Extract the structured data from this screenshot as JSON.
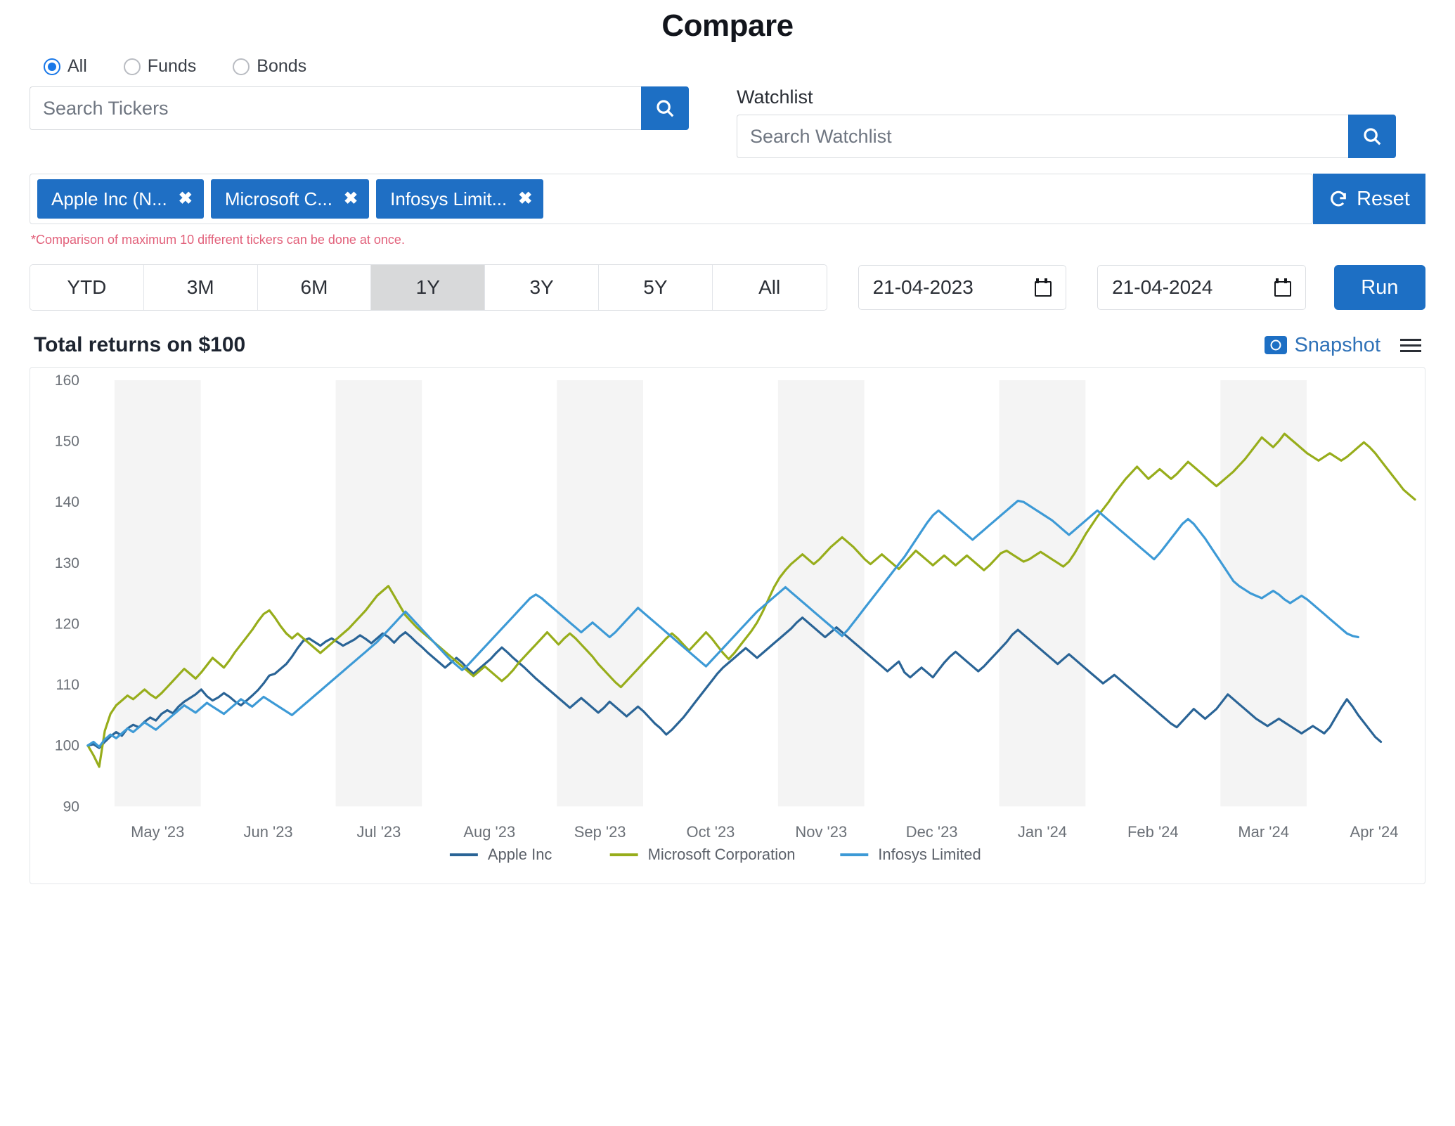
{
  "header": {
    "title": "Compare"
  },
  "filters": {
    "options": [
      {
        "label": "All",
        "checked": true
      },
      {
        "label": "Funds",
        "checked": false
      },
      {
        "label": "Bonds",
        "checked": false
      }
    ]
  },
  "search": {
    "tickers_placeholder": "Search Tickers",
    "tickers_value": "",
    "search_icon": "search-icon"
  },
  "watchlist": {
    "label": "Watchlist",
    "placeholder": "Search Watchlist",
    "value": "",
    "search_icon": "search-icon"
  },
  "chips": [
    {
      "label": "Apple Inc (N...",
      "remove": "✖"
    },
    {
      "label": "Microsoft C...",
      "remove": "✖"
    },
    {
      "label": "Infosys Limit...",
      "remove": "✖"
    }
  ],
  "reset": {
    "label": "Reset",
    "icon": "refresh-icon"
  },
  "note": "*Comparison of maximum 10 different tickers can be done at once.",
  "periods": [
    {
      "label": "YTD",
      "active": false
    },
    {
      "label": "3M",
      "active": false
    },
    {
      "label": "6M",
      "active": false
    },
    {
      "label": "1Y",
      "active": true
    },
    {
      "label": "3Y",
      "active": false
    },
    {
      "label": "5Y",
      "active": false
    },
    {
      "label": "All",
      "active": false
    }
  ],
  "date_from": "21-04-2023",
  "date_to": "21-04-2024",
  "run_label": "Run",
  "chart_header": {
    "title": "Total returns on $100",
    "snapshot_label": "Snapshot",
    "menu_icon": "hamburger-menu-icon",
    "camera_icon": "camera-icon"
  },
  "colors": {
    "accent_blue": "#1d6fc4",
    "apple": "#2a6496",
    "microsoft": "#97ad1b",
    "infosys": "#3d9ad6",
    "note_red": "#e2607a",
    "band": "#f4f4f4"
  },
  "chart_data": {
    "type": "line",
    "title": "Total returns on $100",
    "xlabel": "",
    "ylabel": "",
    "ylim": [
      90,
      160
    ],
    "yticks": [
      90,
      100,
      110,
      120,
      130,
      140,
      150,
      160
    ],
    "grid": false,
    "legend_position": "bottom",
    "x_tick_labels": [
      "May '23",
      "Jun '23",
      "Jul '23",
      "Aug '23",
      "Sep '23",
      "Oct '23",
      "Nov '23",
      "Dec '23",
      "Jan '24",
      "Feb '24",
      "Mar '24",
      "Apr '24"
    ],
    "x_start": "21-04-2023",
    "x_end": "21-04-2024",
    "shaded_bands": "alternating monthly vertical bands",
    "series": [
      {
        "name": "Apple Inc",
        "color": "#2a6496",
        "values": [
          100,
          100.2,
          99.6,
          100.6,
          101.5,
          102.2,
          101.6,
          102.8,
          103.4,
          103.0,
          103.9,
          104.6,
          104.1,
          105.2,
          105.8,
          105.3,
          106.4,
          107.2,
          107.8,
          108.4,
          109.2,
          108.1,
          107.4,
          107.9,
          108.6,
          108.0,
          107.2,
          106.6,
          107.4,
          108.2,
          109.1,
          110.2,
          111.5,
          111.8,
          112.6,
          113.4,
          114.6,
          116.0,
          117.2,
          117.6,
          117.0,
          116.4,
          117.1,
          117.6,
          117.0,
          116.4,
          116.9,
          117.4,
          118.1,
          117.5,
          116.8,
          117.6,
          118.4,
          117.8,
          116.9,
          117.9,
          118.6,
          117.8,
          116.9,
          116.1,
          115.2,
          114.4,
          113.6,
          112.8,
          113.6,
          114.4,
          113.6,
          112.6,
          111.8,
          112.6,
          113.4,
          114.2,
          115.2,
          116.1,
          115.3,
          114.4,
          113.6,
          112.8,
          111.9,
          111.0,
          110.2,
          109.4,
          108.6,
          107.8,
          107.0,
          106.2,
          107.0,
          107.8,
          107.0,
          106.2,
          105.4,
          106.2,
          107.2,
          106.4,
          105.6,
          104.8,
          105.6,
          106.4,
          105.6,
          104.6,
          103.6,
          102.8,
          101.8,
          102.6,
          103.6,
          104.6,
          105.8,
          107.0,
          108.2,
          109.4,
          110.6,
          111.8,
          112.8,
          113.6,
          114.4,
          115.2,
          116.0,
          115.2,
          114.4,
          115.2,
          116.0,
          116.8,
          117.6,
          118.4,
          119.2,
          120.2,
          121.0,
          120.2,
          119.4,
          118.6,
          117.8,
          118.6,
          119.4,
          118.6,
          117.8,
          117.0,
          116.2,
          115.4,
          114.6,
          113.8,
          113.0,
          112.2,
          113.0,
          113.8,
          112.0,
          111.2,
          112.0,
          112.8,
          112.0,
          111.2,
          112.4,
          113.6,
          114.6,
          115.4,
          114.6,
          113.8,
          113.0,
          112.2,
          113.0,
          114.0,
          115.0,
          116.0,
          117.0,
          118.2,
          119.0,
          118.2,
          117.4,
          116.6,
          115.8,
          115.0,
          114.2,
          113.4,
          114.2,
          115.0,
          114.2,
          113.4,
          112.6,
          111.8,
          111.0,
          110.2,
          110.9,
          111.6,
          110.8,
          110.0,
          109.2,
          108.4,
          107.6,
          106.8,
          106.0,
          105.2,
          104.4,
          103.6,
          103.0,
          104.0,
          105.0,
          106.0,
          105.2,
          104.4,
          105.2,
          106.0,
          107.2,
          108.4,
          107.6,
          106.8,
          106.0,
          105.2,
          104.4,
          103.8,
          103.2,
          103.8,
          104.4,
          103.8,
          103.2,
          102.6,
          102.0,
          102.6,
          103.2,
          102.6,
          102.0,
          103.0,
          104.6,
          106.2,
          107.6,
          106.4,
          105.0,
          103.8,
          102.6,
          101.4,
          100.6
        ]
      },
      {
        "name": "Microsoft Corporation",
        "color": "#97ad1b",
        "values": [
          100,
          98.4,
          96.5,
          102.4,
          105.2,
          106.6,
          107.4,
          108.2,
          107.6,
          108.4,
          109.2,
          108.4,
          107.8,
          108.6,
          109.6,
          110.6,
          111.6,
          112.6,
          111.8,
          111.0,
          112.0,
          113.2,
          114.4,
          113.6,
          112.8,
          114.0,
          115.4,
          116.6,
          117.8,
          119.0,
          120.4,
          121.6,
          122.2,
          121.0,
          119.6,
          118.4,
          117.6,
          118.4,
          117.6,
          116.8,
          116.0,
          115.2,
          116.0,
          116.8,
          117.6,
          118.4,
          119.2,
          120.2,
          121.2,
          122.2,
          123.4,
          124.6,
          125.4,
          126.2,
          124.6,
          123.0,
          121.4,
          120.4,
          119.4,
          118.6,
          117.8,
          117.0,
          116.2,
          115.4,
          114.6,
          113.8,
          113.0,
          112.2,
          111.4,
          112.2,
          113.0,
          112.2,
          111.4,
          110.6,
          111.4,
          112.4,
          113.6,
          114.6,
          115.6,
          116.6,
          117.6,
          118.6,
          117.6,
          116.6,
          117.6,
          118.4,
          117.6,
          116.6,
          115.6,
          114.6,
          113.4,
          112.4,
          111.4,
          110.4,
          109.6,
          110.6,
          111.6,
          112.6,
          113.6,
          114.6,
          115.6,
          116.6,
          117.6,
          118.4,
          117.6,
          116.6,
          115.6,
          116.6,
          117.6,
          118.6,
          117.6,
          116.4,
          115.2,
          114.2,
          115.2,
          116.4,
          117.6,
          118.8,
          120.2,
          122.0,
          124.0,
          126.0,
          127.6,
          128.8,
          129.8,
          130.6,
          131.4,
          130.6,
          129.8,
          130.6,
          131.6,
          132.6,
          133.4,
          134.2,
          133.4,
          132.6,
          131.6,
          130.6,
          129.8,
          130.6,
          131.4,
          130.6,
          129.8,
          129.0,
          130.0,
          131.0,
          132.0,
          131.2,
          130.4,
          129.6,
          130.4,
          131.2,
          130.4,
          129.6,
          130.4,
          131.2,
          130.4,
          129.6,
          128.8,
          129.6,
          130.6,
          131.6,
          132.0,
          131.4,
          130.8,
          130.2,
          130.6,
          131.2,
          131.8,
          131.2,
          130.6,
          130.0,
          129.4,
          130.2,
          131.6,
          133.2,
          134.8,
          136.2,
          137.6,
          138.8,
          140.0,
          141.4,
          142.6,
          143.8,
          144.8,
          145.8,
          144.8,
          143.8,
          144.6,
          145.4,
          144.6,
          143.8,
          144.6,
          145.6,
          146.6,
          145.8,
          145.0,
          144.2,
          143.4,
          142.6,
          143.4,
          144.2,
          145.0,
          146.0,
          147.0,
          148.2,
          149.4,
          150.6,
          149.8,
          149.0,
          150.0,
          151.2,
          150.4,
          149.6,
          148.8,
          148.0,
          147.4,
          146.8,
          147.4,
          148.0,
          147.4,
          146.8,
          147.4,
          148.2,
          149.0,
          149.8,
          149.0,
          148.0,
          146.8,
          145.6,
          144.4,
          143.2,
          142.0,
          141.2,
          140.4
        ]
      },
      {
        "name": "Infosys Limited",
        "color": "#3d9ad6",
        "values": [
          100,
          100.6,
          99.8,
          101.0,
          101.8,
          101.2,
          102.0,
          102.8,
          102.2,
          103.0,
          103.8,
          103.2,
          102.6,
          103.4,
          104.2,
          105.0,
          105.8,
          106.6,
          106.0,
          105.4,
          106.2,
          107.0,
          106.4,
          105.8,
          105.2,
          106.0,
          106.8,
          107.6,
          107.0,
          106.4,
          107.2,
          108.0,
          107.4,
          106.8,
          106.2,
          105.6,
          105.0,
          105.8,
          106.6,
          107.4,
          108.2,
          109.0,
          109.8,
          110.6,
          111.4,
          112.2,
          113.0,
          113.8,
          114.6,
          115.4,
          116.2,
          117.0,
          118.0,
          119.0,
          120.0,
          121.0,
          122.0,
          121.0,
          120.0,
          119.0,
          118.0,
          117.0,
          116.0,
          115.0,
          114.0,
          113.2,
          112.4,
          113.2,
          114.2,
          115.2,
          116.2,
          117.2,
          118.2,
          119.2,
          120.2,
          121.2,
          122.2,
          123.2,
          124.2,
          124.8,
          124.2,
          123.4,
          122.6,
          121.8,
          121.0,
          120.2,
          119.4,
          118.6,
          119.4,
          120.2,
          119.4,
          118.6,
          117.8,
          118.6,
          119.6,
          120.6,
          121.6,
          122.6,
          121.8,
          121.0,
          120.2,
          119.4,
          118.6,
          117.8,
          117.0,
          116.2,
          115.4,
          114.6,
          113.8,
          113.0,
          114.0,
          115.0,
          116.0,
          117.0,
          118.0,
          119.0,
          120.0,
          121.0,
          122.0,
          122.8,
          123.6,
          124.4,
          125.2,
          126.0,
          125.2,
          124.4,
          123.6,
          122.8,
          122.0,
          121.2,
          120.4,
          119.6,
          118.8,
          118.0,
          119.0,
          120.2,
          121.4,
          122.6,
          123.8,
          125.0,
          126.2,
          127.4,
          128.6,
          129.8,
          131.0,
          132.4,
          133.8,
          135.2,
          136.6,
          137.8,
          138.6,
          137.8,
          137.0,
          136.2,
          135.4,
          134.6,
          133.8,
          134.6,
          135.4,
          136.2,
          137.0,
          137.8,
          138.6,
          139.4,
          140.2,
          140.0,
          139.4,
          138.8,
          138.2,
          137.6,
          137.0,
          136.2,
          135.4,
          134.6,
          135.4,
          136.2,
          137.0,
          137.8,
          138.6,
          137.8,
          137.0,
          136.2,
          135.4,
          134.6,
          133.8,
          133.0,
          132.2,
          131.4,
          130.6,
          131.6,
          132.8,
          134.0,
          135.2,
          136.4,
          137.2,
          136.4,
          135.2,
          134.0,
          132.6,
          131.2,
          129.8,
          128.4,
          127.0,
          126.2,
          125.6,
          125.0,
          124.6,
          124.2,
          124.8,
          125.4,
          124.8,
          124.0,
          123.4,
          124.0,
          124.6,
          124.0,
          123.2,
          122.4,
          121.6,
          120.8,
          120.0,
          119.2,
          118.4,
          118.0,
          117.8
        ]
      }
    ]
  }
}
